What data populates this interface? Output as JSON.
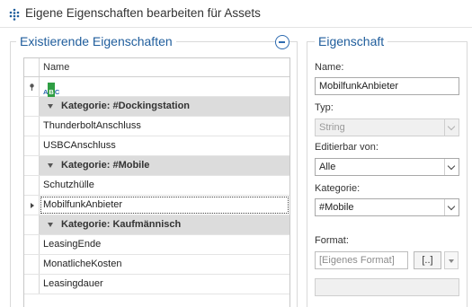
{
  "window": {
    "title": "Eigene Eigenschaften bearbeiten für Assets",
    "app_icon": "grid-dots-icon"
  },
  "left_group": {
    "caption": "Existierende Eigenschaften",
    "collapse_icon": "minus-circle-icon",
    "grid": {
      "column_header": "Name",
      "filter_icon": "abc-filter-icon",
      "rows": [
        {
          "type": "group",
          "label": "Kategorie: #Dockingstation"
        },
        {
          "type": "item",
          "label": "ThunderboltAnschluss"
        },
        {
          "type": "item",
          "label": "USBCAnschluss"
        },
        {
          "type": "group",
          "label": "Kategorie: #Mobile"
        },
        {
          "type": "item",
          "label": "Schutzhülle"
        },
        {
          "type": "item",
          "label": "MobilfunkAnbieter",
          "focused": true
        },
        {
          "type": "group",
          "label": "Kategorie: Kaufmännisch"
        },
        {
          "type": "item",
          "label": "LeasingEnde"
        },
        {
          "type": "item",
          "label": "MonatlicheKosten"
        },
        {
          "type": "item",
          "label": "Leasingdauer"
        }
      ]
    }
  },
  "right_group": {
    "caption": "Eigenschaft",
    "name_label": "Name:",
    "name_value": "MobilfunkAnbieter",
    "type_label": "Typ:",
    "type_value": "String",
    "editable_label": "Editierbar von:",
    "editable_value": "Alle",
    "category_label": "Kategorie:",
    "category_value": "#Mobile",
    "format_label": "Format:",
    "format_placeholder": "[Eigenes Format]",
    "format_button": "[..]",
    "preview_value": ""
  }
}
